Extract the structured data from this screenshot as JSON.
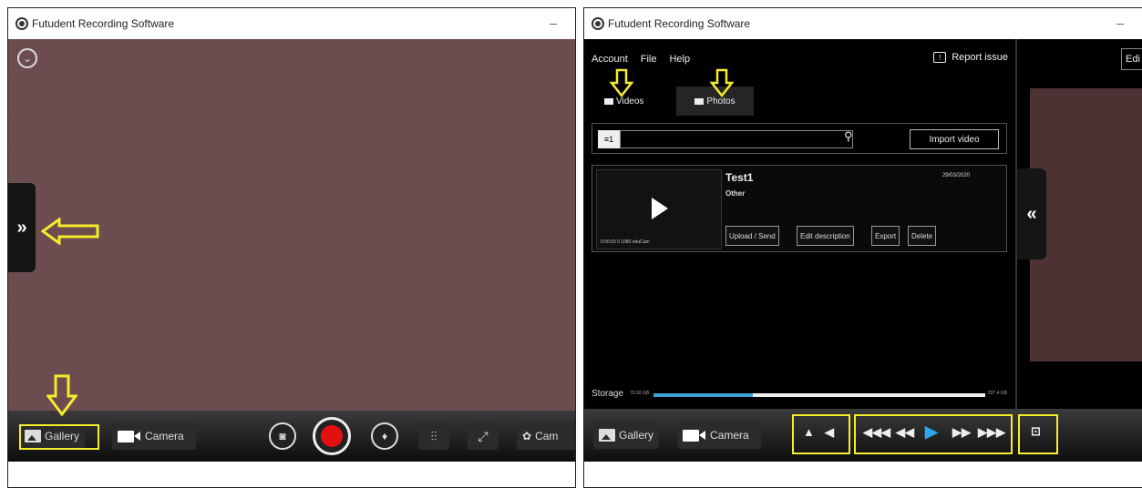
{
  "left": {
    "app_title": "Futudent Recording Software",
    "minimize": "–",
    "gallery_label": "Gallery",
    "camera_label": "Camera",
    "side_toggle": "»",
    "settings_label": "Cam",
    "highlight_color": "#f5ec2c",
    "record_color": "#e21010"
  },
  "right": {
    "app_title": "Futudent Recording Software",
    "minimize": "–",
    "menu": [
      "Account",
      "File",
      "Help"
    ],
    "report_issue": "Report issue",
    "tabs": [
      "Videos",
      "Photos"
    ],
    "video_count": "1",
    "import_label": "Import video",
    "video": {
      "title": "Test1",
      "category": "Other",
      "date": "29/03/2020",
      "meta": "0:00:03  0  1080  eduCam",
      "buttons": [
        "Upload / Send",
        "Edit description",
        "Export",
        "Delete"
      ]
    },
    "storage_label": "Storage",
    "storage_used": "70.92 GB",
    "storage_total": "237.4 GB",
    "storage_used_fraction": 0.3,
    "edit_label": "Edi",
    "side_toggle": "«",
    "gallery_label": "Gallery",
    "camera_label": "Camera",
    "accent_color": "#2ea7ea"
  }
}
